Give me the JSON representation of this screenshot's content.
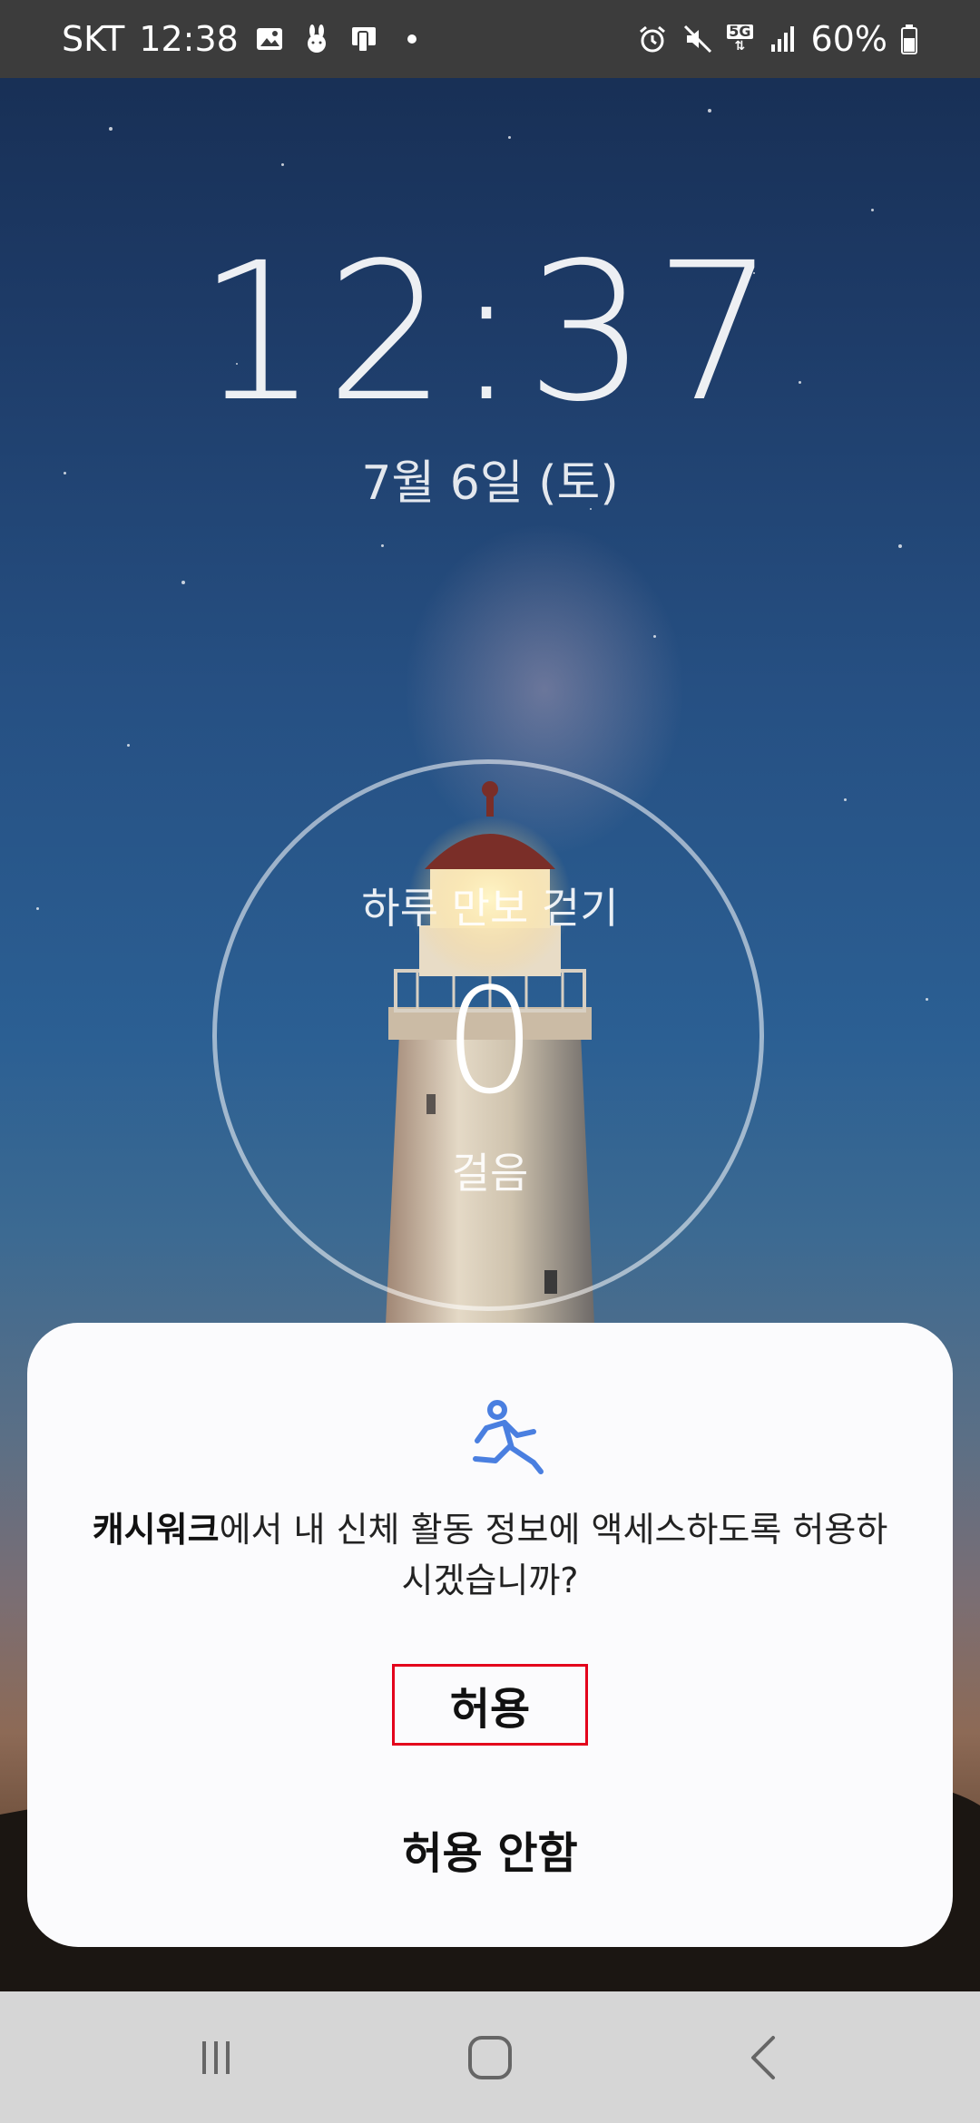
{
  "status_bar": {
    "carrier": "SKT",
    "time": "12:38",
    "battery": "60%",
    "network": "5G",
    "icons": [
      "gallery-icon",
      "rabbit-icon",
      "device-icon",
      "alarm-icon",
      "mute-icon",
      "5g-icon",
      "signal-icon",
      "battery-icon"
    ]
  },
  "lockscreen": {
    "clock": "12:37",
    "date": "7월 6일 (토)"
  },
  "step_widget": {
    "title": "하루 만보 걷기",
    "count": "0",
    "unit": "걸음"
  },
  "dialog": {
    "icon": "running-person-icon",
    "app_name": "캐시워크",
    "message_rest": "에서 내 신체 활동 정보에 액세스하도록 허용하시겠습니까?",
    "allow_label": "허용",
    "deny_label": "허용 안함",
    "accent_color": "#4a7fe0",
    "highlight_color": "#e3001b"
  },
  "nav_bar": {
    "icons": [
      "recent-apps-icon",
      "home-icon",
      "back-icon"
    ]
  }
}
